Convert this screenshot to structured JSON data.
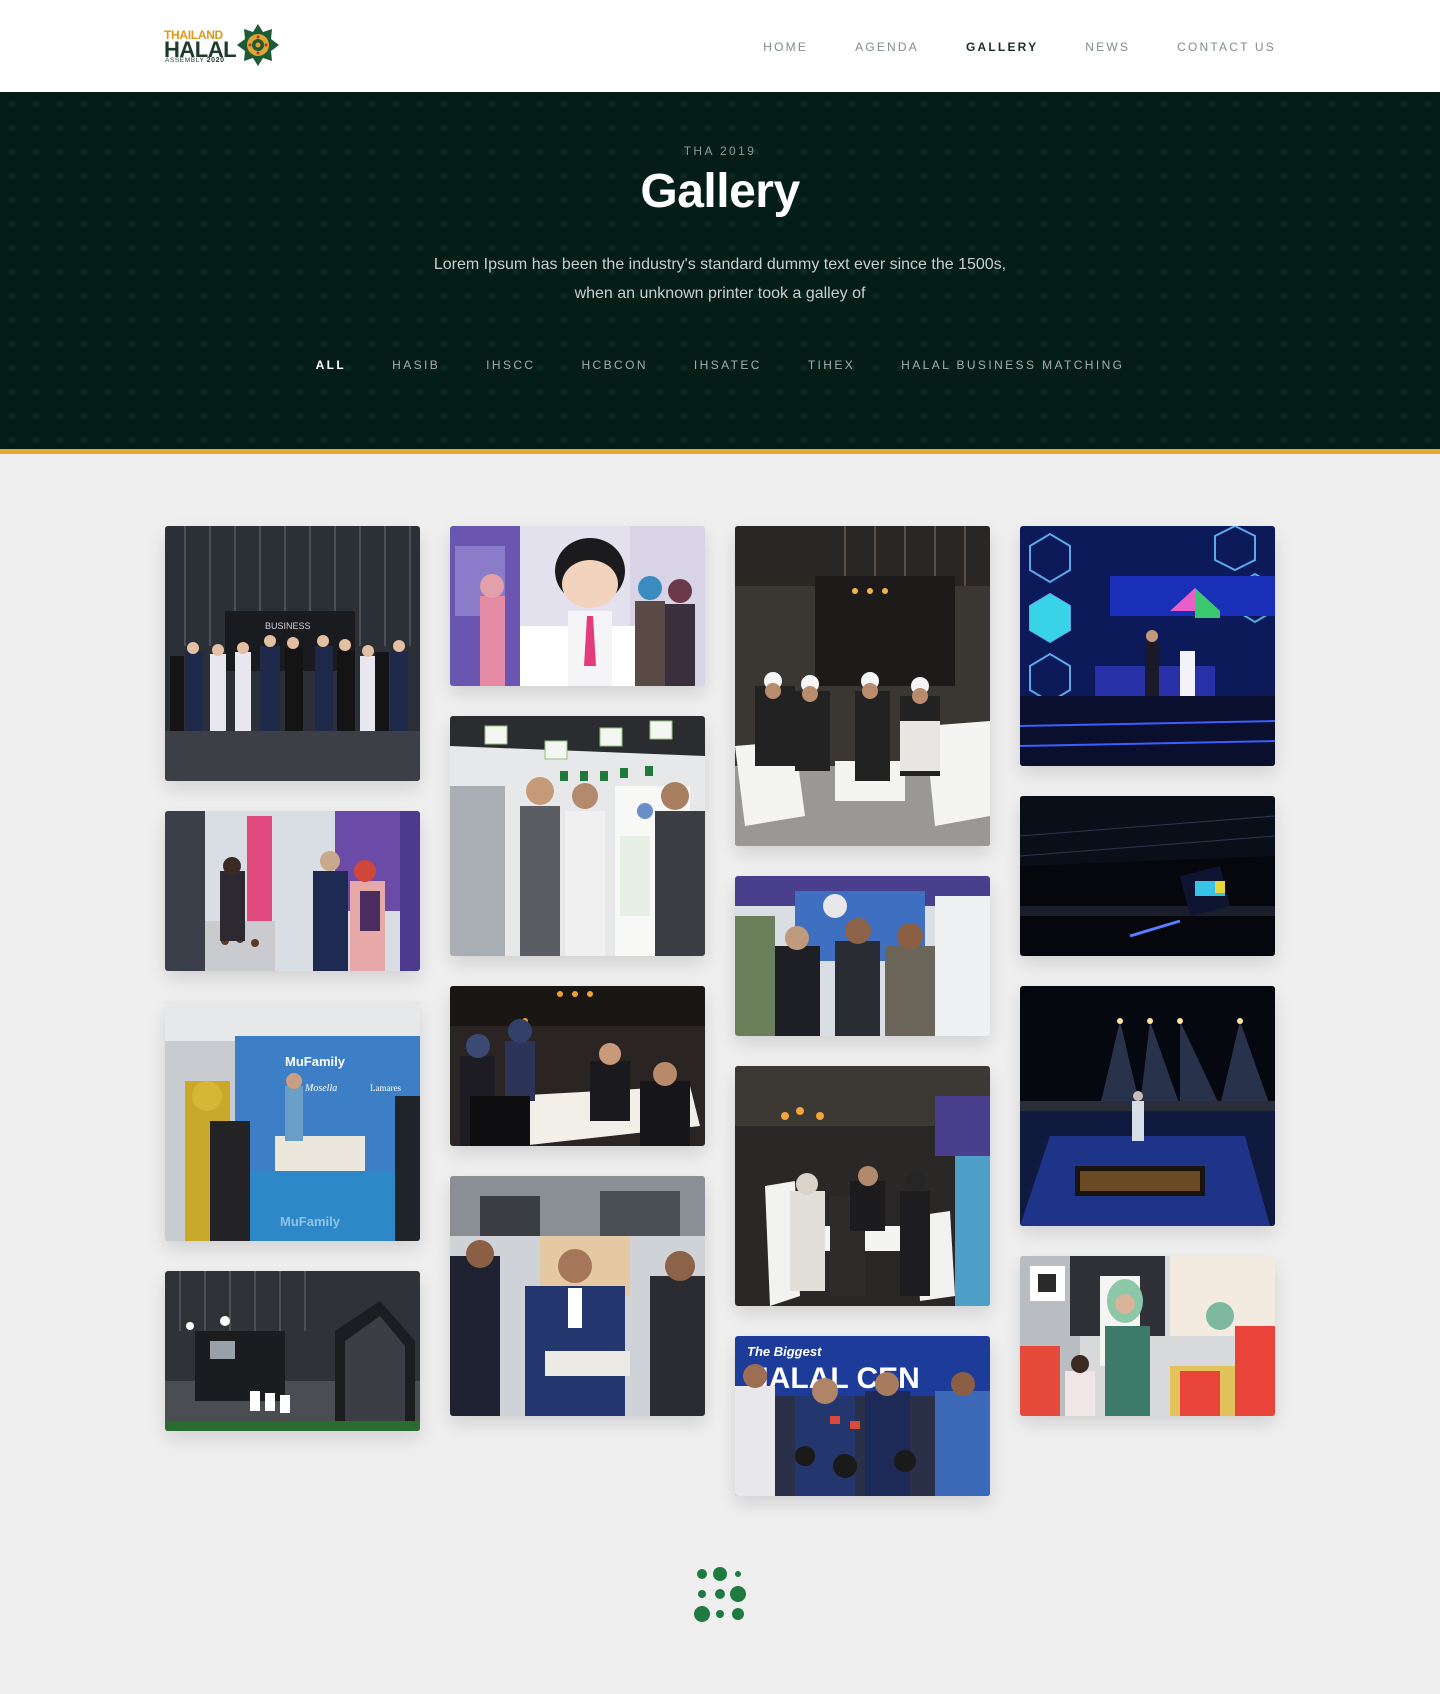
{
  "brand": {
    "line1": "THAILAND",
    "line2": "HALAL",
    "line3": "ASSEMBLY",
    "year": "2020",
    "colors": {
      "gold": "#d99a1c",
      "dark_green": "#1d3a2a",
      "accent": "#e7a62d",
      "hero_bg": "#051d17",
      "loader_green": "#1f7a3f"
    }
  },
  "nav": {
    "items": [
      {
        "label": "HOME",
        "active": false
      },
      {
        "label": "AGENDA",
        "active": false
      },
      {
        "label": "GALLERY",
        "active": true
      },
      {
        "label": "NEWS",
        "active": false
      },
      {
        "label": "CONTACT US",
        "active": false
      }
    ]
  },
  "hero": {
    "kicker": "THA 2019",
    "title": "Gallery",
    "description": "Lorem Ipsum has been the industry's standard dummy text ever since the 1500s, when an unknown printer took a galley of"
  },
  "filters": [
    {
      "label": "ALL",
      "active": true
    },
    {
      "label": "HASIB",
      "active": false
    },
    {
      "label": "IHSCC",
      "active": false
    },
    {
      "label": "HCBCON",
      "active": false
    },
    {
      "label": "IHSATEC",
      "active": false
    },
    {
      "label": "TIHEX",
      "active": false
    },
    {
      "label": "HALAL BUSINESS MATCHING",
      "active": false
    }
  ],
  "photo_texts": {
    "business_sign": "BUSINESS",
    "mufamily": "MuFamily",
    "mufamily_sub": "Mosella",
    "lamares": "Lamares",
    "biggest": "The Biggest",
    "halal_cen": "HALAL CEN"
  },
  "gallery_icon": "photo-tile",
  "loader_icon": "dot-grid-loader-icon"
}
